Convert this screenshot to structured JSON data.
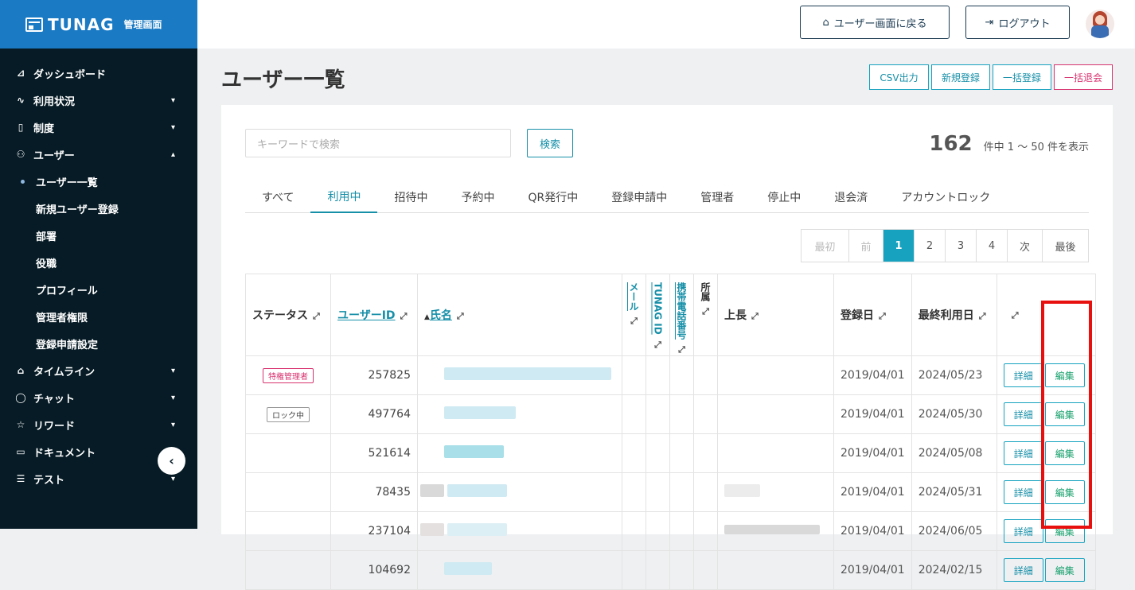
{
  "app": {
    "logo": "TUNAG",
    "logo_sub": "管理画面"
  },
  "sidebar": {
    "items": [
      {
        "label": "ダッシュボード",
        "icon": "chart-icon",
        "chevron": ""
      },
      {
        "label": "利用状況",
        "icon": "pulse-icon",
        "chevron": "⌄"
      },
      {
        "label": "制度",
        "icon": "book-icon",
        "chevron": "⌄"
      },
      {
        "label": "ユーザー",
        "icon": "users-icon",
        "chevron": "⌃"
      }
    ],
    "sub_items": [
      {
        "label": "ユーザー一覧",
        "active": true
      },
      {
        "label": "新規ユーザー登録"
      },
      {
        "label": "部署"
      },
      {
        "label": "役職"
      },
      {
        "label": "プロフィール"
      },
      {
        "label": "管理者権限"
      },
      {
        "label": "登録申請設定"
      }
    ],
    "items2": [
      {
        "label": "タイムライン",
        "icon": "home-icon",
        "chevron": "⌄"
      },
      {
        "label": "チャット",
        "icon": "chat-icon",
        "chevron": "⌄"
      },
      {
        "label": "リワード",
        "icon": "star-icon",
        "chevron": "⌄"
      },
      {
        "label": "ドキュメント",
        "icon": "folder-icon",
        "chevron": "⌄"
      },
      {
        "label": "テスト",
        "icon": "list-icon",
        "chevron": "⌄"
      }
    ]
  },
  "header": {
    "back_label": "ユーザー画面に戻る",
    "logout_label": "ログアウト"
  },
  "page": {
    "title": "ユーザー一覧"
  },
  "actions": {
    "csv": "CSV出力",
    "new": "新規登録",
    "bulk_register": "一括登録",
    "bulk_withdraw": "一括退会"
  },
  "search": {
    "placeholder": "キーワードで検索",
    "button": "検索"
  },
  "result": {
    "total": "162",
    "range_text": "件中 1 〜 50 件を表示"
  },
  "tabs": [
    "すべて",
    "利用中",
    "招待中",
    "予約中",
    "QR発行中",
    "登録申請中",
    "管理者",
    "停止中",
    "退会済",
    "アカウントロック"
  ],
  "active_tab": 1,
  "pager": {
    "first": "最初",
    "prev": "前",
    "pages": [
      "1",
      "2",
      "3",
      "4"
    ],
    "current": "1",
    "next": "次",
    "last": "最後"
  },
  "table": {
    "headers": {
      "status": "ステータス",
      "user_id": "ユーザーID",
      "name": "氏名",
      "mail": "メール",
      "tunag_id": "TUNAG ID",
      "phone": "携帯電話番号",
      "dept": "所属",
      "boss": "上長",
      "registered": "登録日",
      "last_used": "最終利用日"
    },
    "detail_label": "詳細",
    "edit_label": "編集",
    "rows": [
      {
        "status": "特権管理者",
        "id": "257825",
        "registered": "2019/04/01",
        "last_used": "2024/05/23"
      },
      {
        "status": "ロック中",
        "id": "497764",
        "registered": "2019/04/01",
        "last_used": "2024/05/30"
      },
      {
        "status": "",
        "id": "521614",
        "registered": "2019/04/01",
        "last_used": "2024/05/08"
      },
      {
        "status": "",
        "id": "78435",
        "registered": "2019/04/01",
        "last_used": "2024/05/31"
      },
      {
        "status": "",
        "id": "237104",
        "registered": "2019/04/01",
        "last_used": "2024/06/05"
      },
      {
        "status": "",
        "id": "104692",
        "registered": "2019/04/01",
        "last_used": "2024/02/15"
      }
    ]
  },
  "colors": {
    "brand": "#1a7ac4",
    "accent": "#17a3c0",
    "danger": "#d8336f",
    "sidebar": "#061b25",
    "highlight": "#e8100e"
  }
}
